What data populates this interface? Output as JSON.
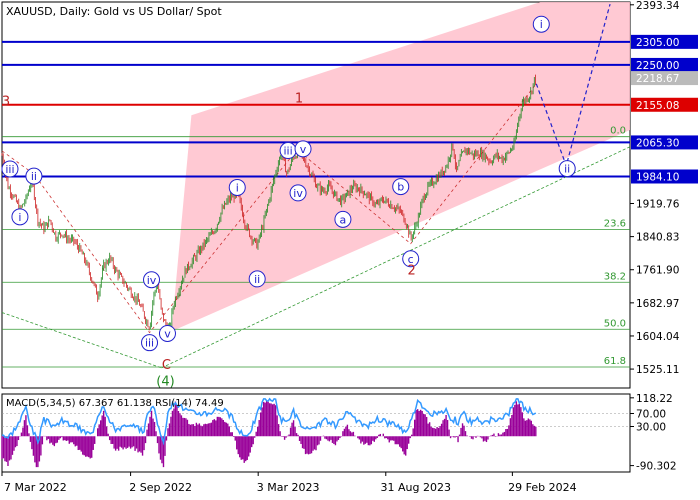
{
  "chart_data": {
    "type": "line",
    "title": "XAUUSD, Daily:  Gold vs US Dollar/ Spot",
    "x_ticks": [
      "7 Mar 2022",
      "2 Sep 2022",
      "3 Mar 2023",
      "31 Aug 2023",
      "29 Feb 2024"
    ],
    "y_ticks": [
      2393.34,
      2305.0,
      2250.0,
      2218.67,
      2155.08,
      2065.3,
      1984.1,
      1919.76,
      1840.83,
      1761.9,
      1682.97,
      1604.04,
      1525.11
    ],
    "y_tick_labels": [
      "2393.34",
      "2305.00",
      "2250.00",
      "2218.67",
      "2155.08",
      "2065.30",
      "1984.10",
      "1919.76",
      "1840.83",
      "1761.90",
      "1682.97",
      "1604.04",
      "1525.11"
    ],
    "ylim": [
      1480,
      2400
    ],
    "current_price": 2218.67,
    "levels": [
      {
        "label": "2305.00",
        "value": 2305.0,
        "color": "#0000cc"
      },
      {
        "label": "2250.00",
        "value": 2250.0,
        "color": "#0000cc"
      },
      {
        "label": "2155.08",
        "value": 2155.08,
        "color": "#dd0000"
      },
      {
        "label": "2065.30",
        "value": 2065.3,
        "color": "#0000cc"
      },
      {
        "label": "1984.10",
        "value": 1984.1,
        "color": "#0000cc"
      }
    ],
    "fib_levels": [
      {
        "label": "0.0",
        "value": 2079
      },
      {
        "label": "23.6",
        "value": 1858
      },
      {
        "label": "38.2",
        "value": 1732
      },
      {
        "label": "50.0",
        "value": 1620
      },
      {
        "label": "61.8",
        "value": 1530
      }
    ],
    "price_series": [
      [
        0,
        2035
      ],
      [
        6,
        1960
      ],
      [
        12,
        1935
      ],
      [
        18,
        1905
      ],
      [
        24,
        1930
      ],
      [
        30,
        1980
      ],
      [
        36,
        1880
      ],
      [
        42,
        1860
      ],
      [
        48,
        1880
      ],
      [
        54,
        1840
      ],
      [
        60,
        1850
      ],
      [
        66,
        1835
      ],
      [
        72,
        1830
      ],
      [
        78,
        1810
      ],
      [
        84,
        1780
      ],
      [
        90,
        1740
      ],
      [
        96,
        1700
      ],
      [
        102,
        1770
      ],
      [
        108,
        1790
      ],
      [
        114,
        1760
      ],
      [
        120,
        1740
      ],
      [
        126,
        1720
      ],
      [
        132,
        1700
      ],
      [
        138,
        1680
      ],
      [
        144,
        1645
      ],
      [
        148,
        1625
      ],
      [
        152,
        1700
      ],
      [
        156,
        1730
      ],
      [
        160,
        1660
      ],
      [
        164,
        1630
      ],
      [
        168,
        1620
      ],
      [
        172,
        1680
      ],
      [
        178,
        1720
      ],
      [
        184,
        1760
      ],
      [
        190,
        1780
      ],
      [
        196,
        1800
      ],
      [
        202,
        1820
      ],
      [
        208,
        1840
      ],
      [
        214,
        1860
      ],
      [
        220,
        1900
      ],
      [
        226,
        1925
      ],
      [
        232,
        1940
      ],
      [
        238,
        1930
      ],
      [
        244,
        1870
      ],
      [
        250,
        1840
      ],
      [
        256,
        1820
      ],
      [
        262,
        1870
      ],
      [
        268,
        1930
      ],
      [
        274,
        1990
      ],
      [
        280,
        2040
      ],
      [
        286,
        1990
      ],
      [
        292,
        2030
      ],
      [
        298,
        2045
      ],
      [
        304,
        2020
      ],
      [
        310,
        1990
      ],
      [
        316,
        1960
      ],
      [
        322,
        1950
      ],
      [
        328,
        1960
      ],
      [
        334,
        1940
      ],
      [
        340,
        1925
      ],
      [
        346,
        1940
      ],
      [
        352,
        1960
      ],
      [
        358,
        1955
      ],
      [
        364,
        1945
      ],
      [
        370,
        1930
      ],
      [
        376,
        1915
      ],
      [
        382,
        1930
      ],
      [
        388,
        1920
      ],
      [
        394,
        1910
      ],
      [
        400,
        1900
      ],
      [
        406,
        1870
      ],
      [
        410,
        1835
      ],
      [
        414,
        1860
      ],
      [
        418,
        1890
      ],
      [
        422,
        1930
      ],
      [
        428,
        1960
      ],
      [
        434,
        1975
      ],
      [
        440,
        1990
      ],
      [
        446,
        2010
      ],
      [
        452,
        2060
      ],
      [
        456,
        1995
      ],
      [
        460,
        2030
      ],
      [
        466,
        2050
      ],
      [
        472,
        2035
      ],
      [
        478,
        2040
      ],
      [
        484,
        2035
      ],
      [
        490,
        2020
      ],
      [
        496,
        2035
      ],
      [
        502,
        2025
      ],
      [
        508,
        2040
      ],
      [
        514,
        2060
      ],
      [
        518,
        2120
      ],
      [
        522,
        2160
      ],
      [
        526,
        2170
      ],
      [
        530,
        2180
      ],
      [
        534,
        2215
      ]
    ],
    "macd": {
      "label": "MACD(5,34,5) 67.367 61.138 RSI(14) 74.49",
      "y_ticks": [
        118.22,
        70.0,
        30.0,
        -90.302
      ],
      "y_tick_labels": [
        "118.22",
        "70.00",
        "30.00",
        "-90.302"
      ],
      "hist_color": "#990099",
      "line_color": "#3399ff"
    },
    "wave_labels": [
      {
        "text": "iii",
        "color": "#2222cc",
        "circle": true,
        "price": 2002,
        "bar": 8
      },
      {
        "text": "ii",
        "color": "#2222cc",
        "circle": true,
        "price": 1985,
        "bar": 32
      },
      {
        "text": "i",
        "color": "#2222cc",
        "circle": true,
        "price": 1888,
        "bar": 18
      },
      {
        "text": "iv",
        "color": "#2222cc",
        "circle": true,
        "price": 1738,
        "bar": 150
      },
      {
        "text": "iii",
        "color": "#2222cc",
        "circle": true,
        "price": 1588,
        "bar": 148
      },
      {
        "text": "v",
        "color": "#2222cc",
        "circle": true,
        "price": 1610,
        "bar": 166
      },
      {
        "text": "i",
        "color": "#2222cc",
        "circle": true,
        "price": 1958,
        "bar": 236
      },
      {
        "text": "ii",
        "color": "#2222cc",
        "circle": true,
        "price": 1740,
        "bar": 256
      },
      {
        "text": "iii",
        "color": "#2222cc",
        "circle": true,
        "price": 2046,
        "bar": 287
      },
      {
        "text": "v",
        "color": "#2222cc",
        "circle": true,
        "price": 2050,
        "bar": 302
      },
      {
        "text": "iv",
        "color": "#2222cc",
        "circle": true,
        "price": 1945,
        "bar": 297
      },
      {
        "text": "a",
        "color": "#2222cc",
        "circle": true,
        "price": 1882,
        "bar": 342
      },
      {
        "text": "b",
        "color": "#2222cc",
        "circle": true,
        "price": 1960,
        "bar": 400
      },
      {
        "text": "c",
        "color": "#2222cc",
        "circle": true,
        "price": 1788,
        "bar": 410
      },
      {
        "text": "ii",
        "color": "#2222cc",
        "circle": true,
        "price": 2003,
        "bar": 567
      },
      {
        "text": "i",
        "color": "#2222cc",
        "circle": true,
        "price": 2347,
        "bar": 541
      },
      {
        "text": "1",
        "color": "#bb2222",
        "circle": false,
        "price": 2170,
        "bar": 298
      },
      {
        "text": "2",
        "color": "#bb2222",
        "circle": false,
        "price": 1760,
        "bar": 411
      },
      {
        "text": "C",
        "color": "#bb2222",
        "circle": false,
        "price": 1535,
        "bar": 165
      },
      {
        "text": "(4)",
        "color": "#228822",
        "circle": false,
        "price": 1495,
        "bar": 164
      },
      {
        "text": "3",
        "color": "#bb2222",
        "circle": false,
        "price": 2163,
        "bar": 4
      }
    ]
  }
}
